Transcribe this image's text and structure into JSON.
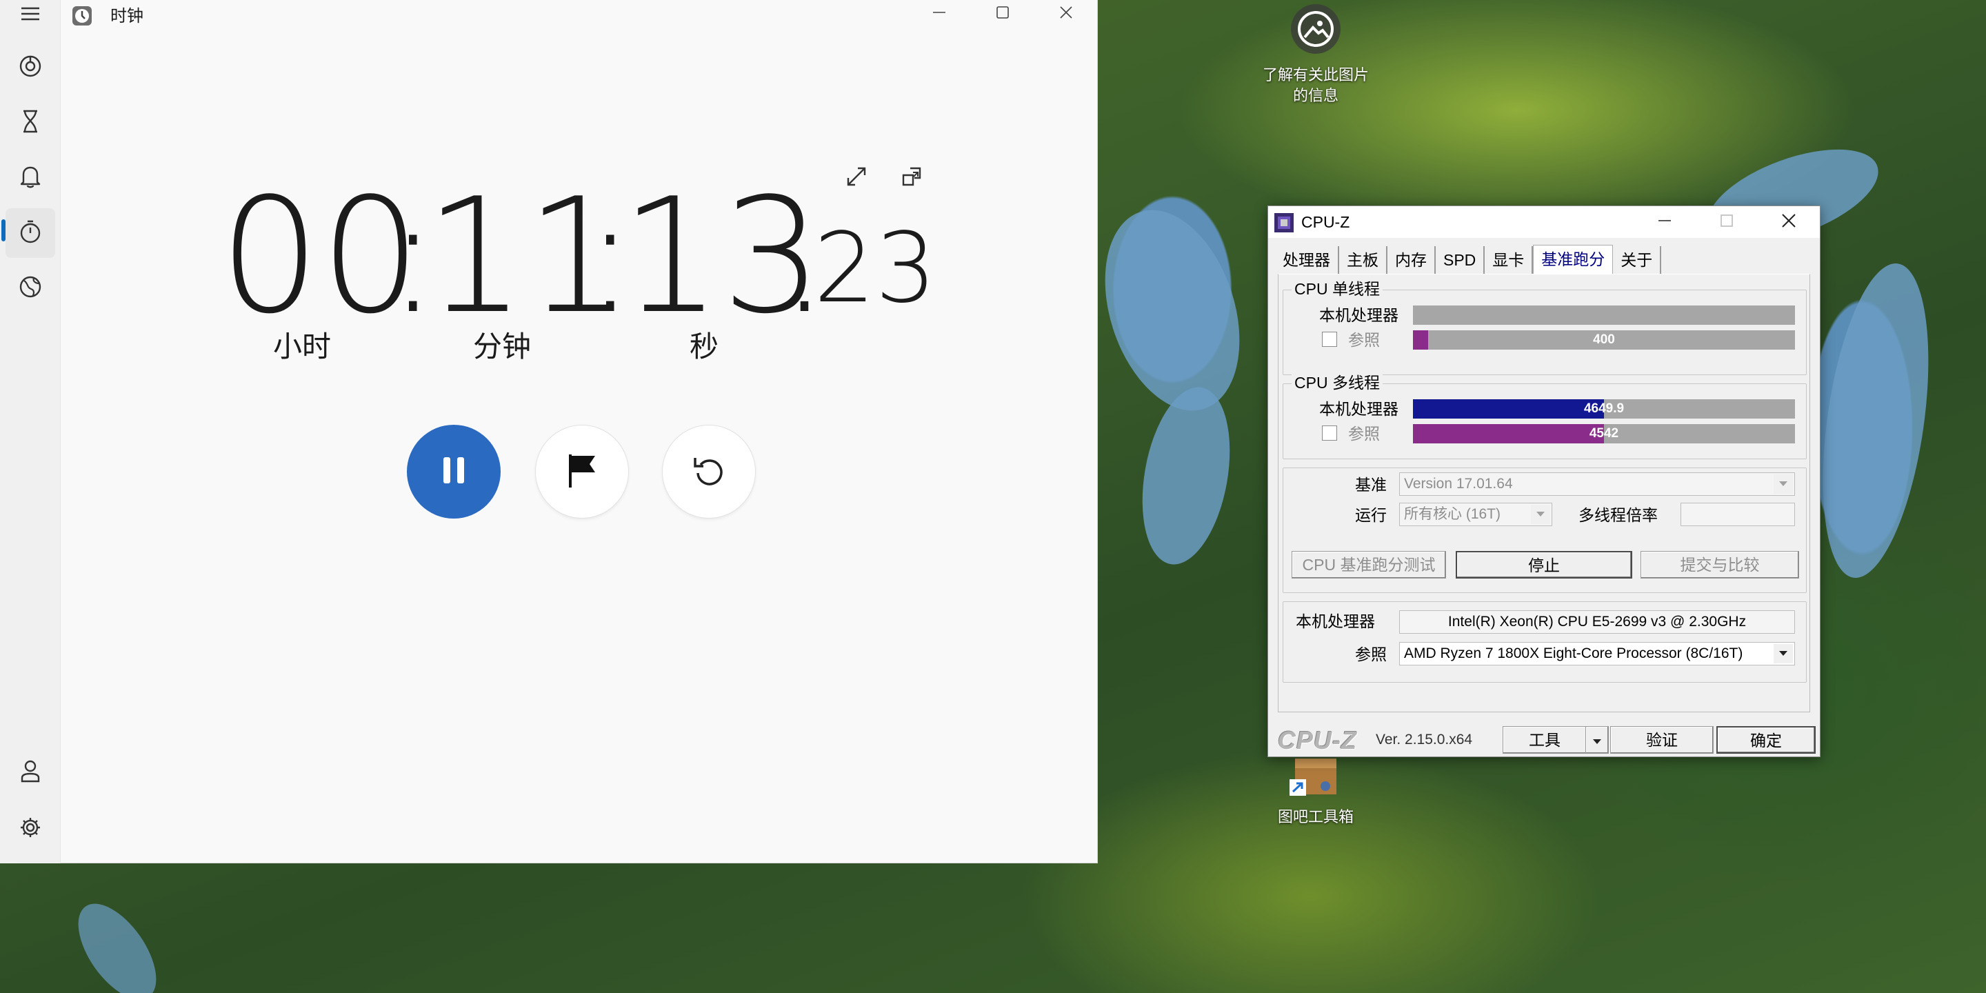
{
  "desktop": {
    "icons": [
      {
        "label": "了解有关此图片的信息",
        "icon": "image-info-icon"
      },
      {
        "label": "图吧工具箱",
        "icon": "toolbox-box-icon"
      }
    ]
  },
  "clock": {
    "title": "时钟",
    "nav": [
      {
        "name": "focus-sessions",
        "icon": "focus-icon"
      },
      {
        "name": "timer",
        "icon": "hourglass-icon"
      },
      {
        "name": "alarm",
        "icon": "bell-icon"
      },
      {
        "name": "stopwatch",
        "icon": "stopwatch-icon",
        "active": true
      },
      {
        "name": "world-clock",
        "icon": "globe-icon"
      }
    ],
    "stopwatch": {
      "hours": "00",
      "minutes": "11",
      "seconds": "13",
      "hundredths": "23",
      "sep": ":",
      "dot": ".",
      "label_hours": "小时",
      "label_minutes": "分钟",
      "label_seconds": "秒"
    }
  },
  "cpuz": {
    "title": "CPU-Z",
    "tabs": [
      "处理器",
      "主板",
      "内存",
      "SPD",
      "显卡",
      "基准跑分",
      "关于"
    ],
    "active_tab": "基准跑分",
    "single": {
      "group_title": "CPU 单线程",
      "this_label": "本机处理器",
      "ref_label": "参照",
      "this_value": "",
      "this_fraction": 0.0,
      "ref_value": "400",
      "ref_fraction": 0.04
    },
    "multi": {
      "group_title": "CPU 多线程",
      "this_label": "本机处理器",
      "ref_label": "参照",
      "this_value": "4649.9",
      "this_fraction": 0.5,
      "ref_value": "4542",
      "ref_fraction": 0.5
    },
    "bench": {
      "label": "基准",
      "value": "Version 17.01.64",
      "run_label": "运行",
      "run_value": "所有核心 (16T)",
      "ratio_label": "多线程倍率",
      "ratio_value": ""
    },
    "buttons": {
      "bench": "CPU 基准跑分测试",
      "stop": "停止",
      "submit": "提交与比较"
    },
    "proc": {
      "this_label": "本机处理器",
      "this_value": "Intel(R) Xeon(R) CPU E5-2699 v3 @ 2.30GHz",
      "ref_label": "参照",
      "ref_value": "AMD Ryzen 7 1800X Eight-Core Processor (8C/16T)"
    },
    "footer": {
      "brand": "CPU-Z",
      "version": "Ver. 2.15.0.x64",
      "tools": "工具",
      "validate": "验证",
      "ok": "确定"
    },
    "colors": {
      "multi_this": "#121891",
      "ref": "#8a2c8a",
      "bar_bg": "#a6a6a6"
    }
  }
}
